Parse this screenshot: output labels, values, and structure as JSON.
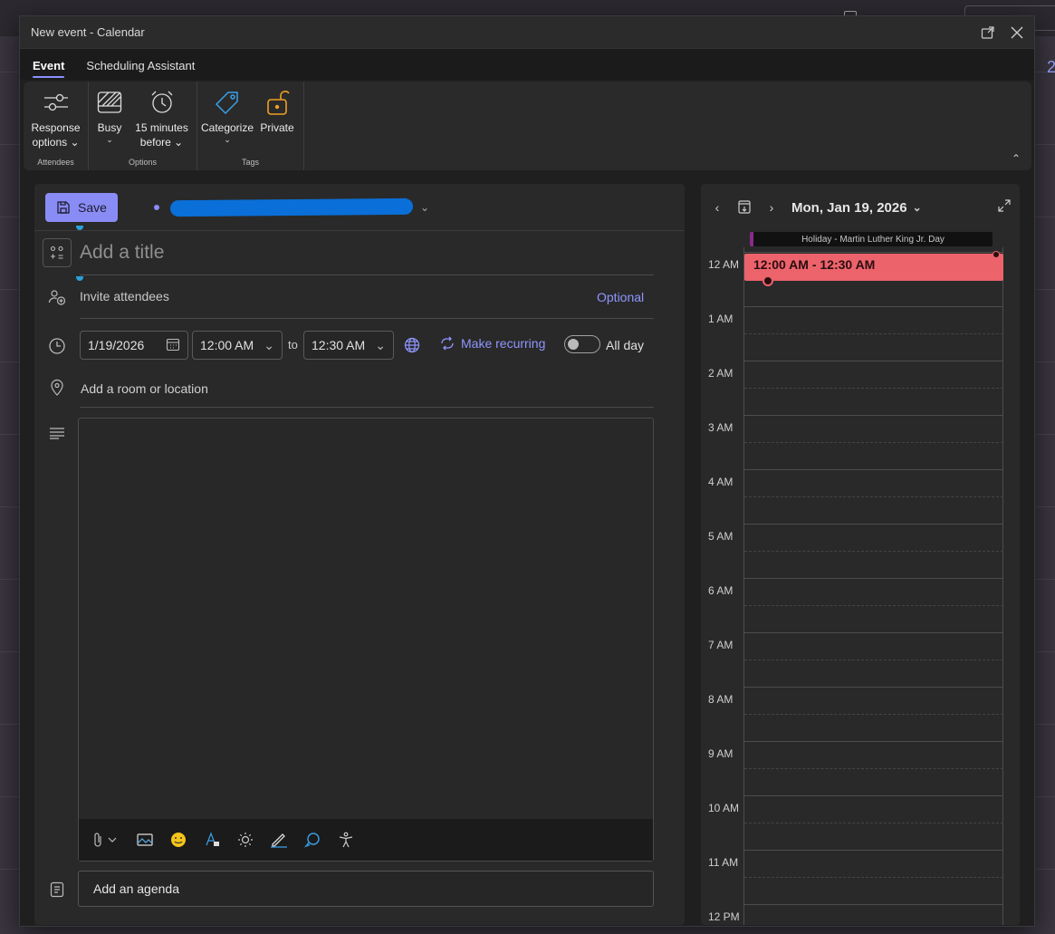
{
  "window": {
    "title": "New event - Calendar"
  },
  "tabs": [
    {
      "label": "Event",
      "active": true
    },
    {
      "label": "Scheduling Assistant",
      "active": false
    }
  ],
  "ribbon": {
    "groups": [
      {
        "label": "Attendees",
        "buttons": [
          {
            "label_line1": "Response",
            "label_line2": "options",
            "icon": "sliders-icon"
          }
        ]
      },
      {
        "label": "Options",
        "buttons": [
          {
            "label_line1": "Busy",
            "label_line2": "",
            "icon": "busy-status-icon"
          },
          {
            "label_line1": "15 minutes",
            "label_line2": "before",
            "icon": "alarm-clock-icon"
          }
        ]
      },
      {
        "label": "Tags",
        "buttons": [
          {
            "label_line1": "Categorize",
            "label_line2": "",
            "icon": "tag-icon"
          },
          {
            "label_line1": "Private",
            "label_line2": "",
            "icon": "unlocked-padlock-icon"
          }
        ]
      }
    ]
  },
  "form": {
    "save_label": "Save",
    "title_placeholder": "Add a title",
    "attendees_placeholder": "Invite attendees",
    "optional_label": "Optional",
    "start_date": "1/19/2026",
    "start_time": "12:00 AM",
    "to_label": "to",
    "end_time": "12:30 AM",
    "make_recurring": "Make recurring",
    "all_day_label": "All day",
    "all_day_on": false,
    "location_placeholder": "Add a room or location",
    "agenda_placeholder": "Add an agenda"
  },
  "calendar": {
    "date_label": "Mon, Jan 19, 2026",
    "holiday": "Holiday - Martin Luther King Jr. Day",
    "event_time": "12:00 AM - 12:30 AM",
    "event_color": "#ec636b",
    "hours": [
      "12 AM",
      "1 AM",
      "2 AM",
      "3 AM",
      "4 AM",
      "5 AM",
      "6 AM",
      "7 AM",
      "8 AM",
      "9 AM",
      "10 AM",
      "11 AM",
      "12 PM"
    ]
  },
  "colors": {
    "accent": "#8a8cf6",
    "link": "#8f96ff",
    "account_redaction": "#0a6fd8"
  }
}
